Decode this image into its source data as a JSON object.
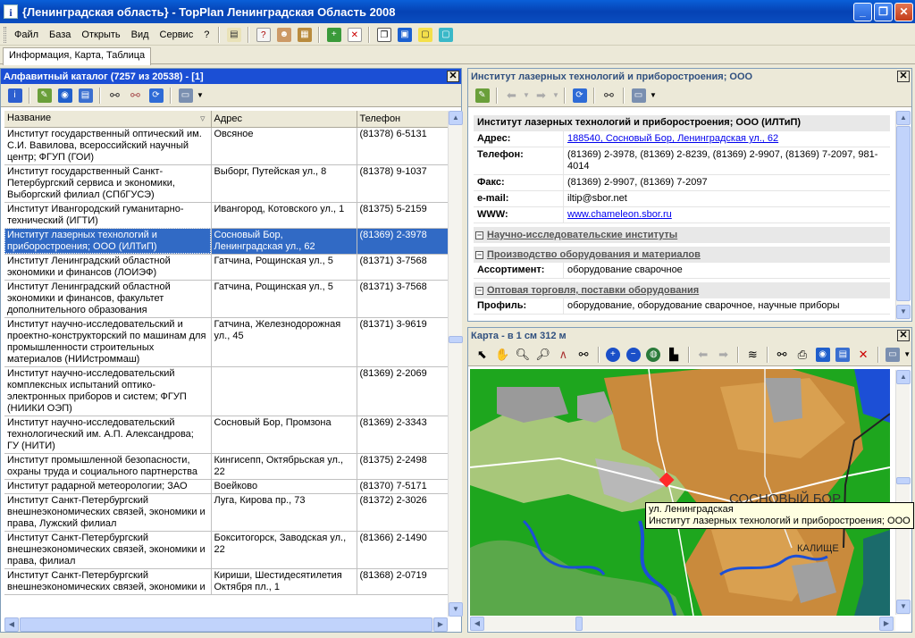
{
  "window": {
    "title": "{Ленинградская область} - TopPlan Ленинградская Область 2008",
    "app_icon": "i"
  },
  "menu": [
    "Файл",
    "База",
    "Открыть",
    "Вид",
    "Сервис",
    "?"
  ],
  "tab": "Информация, Карта, Таблица",
  "catalog": {
    "title": "Алфавитный каталог (7257 из 20538) - [1]",
    "columns": [
      "Название",
      "Адрес",
      "Телефон"
    ],
    "rows": [
      {
        "name": "Институт государственный оптический им. С.И. Вавилова, всероссийский научный центр; ФГУП (ГОИ)",
        "address": "Овсяное",
        "phone": "(81378) 6-5131"
      },
      {
        "name": "Институт государственный Санкт-Петербургский сервиса и экономики, Выборгский филиал (СПбГУСЭ)",
        "address": "Выборг, Путейская ул., 8",
        "phone": "(81378) 9-1037"
      },
      {
        "name": "Институт Ивангородский гуманитарно-технический (ИГТИ)",
        "address": "Ивангород, Котовского ул., 1",
        "phone": "(81375) 5-2159"
      },
      {
        "name": "Институт лазерных технологий и приборостроения; ООО (ИЛТиП)",
        "address": "Сосновый Бор, Ленинградская ул., 62",
        "phone": "(81369) 2-3978",
        "selected": true
      },
      {
        "name": "Институт Ленинградский областной экономики и финансов (ЛОИЭФ)",
        "address": "Гатчина, Рощинская ул., 5",
        "phone": "(81371) 3-7568"
      },
      {
        "name": "Институт Ленинградский областной экономики и финансов, факультет дополнительного образования",
        "address": "Гатчина, Рощинская ул., 5",
        "phone": "(81371) 3-7568"
      },
      {
        "name": "Институт научно-исследовательский и проектно-конструкторский по машинам для промышленности строительных материалов (НИИстроммаш)",
        "address": "Гатчина, Железнодорожная ул., 45",
        "phone": "(81371) 3-9619"
      },
      {
        "name": "Институт научно-исследовательский комплексных испытаний оптико-электронных приборов и систем; ФГУП (НИИКИ ОЭП)",
        "address": "",
        "phone": "(81369) 2-2069"
      },
      {
        "name": "Институт научно-исследовательский технологический им. А.П. Александрова; ГУ (НИТИ)",
        "address": "Сосновый Бор, Промзона",
        "phone": "(81369) 2-3343"
      },
      {
        "name": "Институт промышленной безопасности, охраны труда и социального партнерства",
        "address": "Кингисепп, Октябрьская ул., 22",
        "phone": "(81375) 2-2498"
      },
      {
        "name": "Институт радарной метеорологии; ЗАО",
        "address": "Воейково",
        "phone": "(81370) 7-5171"
      },
      {
        "name": "Институт Санкт-Петербургский внешнеэкономических связей, экономики и права, Лужский филиал",
        "address": "Луга, Кирова пр., 73",
        "phone": "(81372) 2-3026"
      },
      {
        "name": "Институт Санкт-Петербургский внешнеэкономических связей, экономики и права, филиал",
        "address": "Бокситогорск, Заводская ул., 22",
        "phone": "(81366) 2-1490"
      },
      {
        "name": "Институт Санкт-Петербургский внешнеэкономических связей, экономики и",
        "address": "Кириши, Шестидесятилетия Октября пл., 1",
        "phone": "(81368) 2-0719"
      }
    ]
  },
  "detail": {
    "title": "Институт лазерных технологий и приборостроения; ООО",
    "org_name": "Институт лазерных технологий и приборостроения; ООО (ИЛТиП)",
    "fields": [
      {
        "label": "Адрес:",
        "value": "188540, Сосновый Бор, Ленинградская ул., 62",
        "link": true
      },
      {
        "label": "Телефон:",
        "value": "(81369) 2-3978, (81369) 2-8239, (81369) 2-9907, (81369) 7-2097, 981-4014"
      },
      {
        "label": "Факс:",
        "value": "(81369) 2-9907, (81369) 7-2097"
      },
      {
        "label": "e-mail:",
        "value": "iltip@sbor.net"
      },
      {
        "label": "WWW:",
        "value": "www.chameleon.sbor.ru",
        "link": true
      }
    ],
    "sections": [
      {
        "title": "Научно-исследовательские институты",
        "rows": []
      },
      {
        "title": "Производство оборудования и материалов",
        "rows": [
          {
            "label": "Ассортимент:",
            "value": "оборудование сварочное"
          }
        ]
      },
      {
        "title": "Оптовая торговля, поставки оборудования",
        "rows": [
          {
            "label": "Профиль:",
            "value": "оборудование, оборудование сварочное, научные приборы"
          }
        ]
      }
    ]
  },
  "map": {
    "title": "Карта - в 1 см 312 м",
    "labels": {
      "town": "СОСНОВЫЙ БОР",
      "village": "КАЛИЩЕ"
    },
    "tooltip": {
      "line1": "ул. Ленинградская",
      "line2": "Институт лазерных технологий и приборостроения; ООО"
    }
  },
  "colors": {
    "selection": "#316ac5",
    "active_header": "#1b4fd5",
    "map_green": "#1ea61e",
    "map_orange": "#c98a3c",
    "map_water": "#1c4fd6",
    "marker": "#ff2a2a"
  }
}
